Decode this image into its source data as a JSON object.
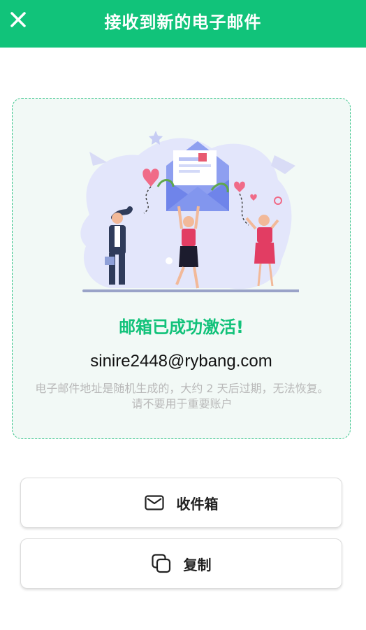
{
  "header": {
    "title": "接收到新的电子邮件",
    "close_icon": "close-icon"
  },
  "card": {
    "success_title": "邮箱已成功激活!",
    "email": "sinire2448@rybang.com",
    "hint": "电子邮件地址是随机生成的，大约 2 天后过期，无法恢复。请不要用于重要账户"
  },
  "actions": {
    "inbox": {
      "label": "收件箱",
      "icon": "mail-icon"
    },
    "copy": {
      "label": "复制",
      "icon": "copy-icon"
    }
  },
  "colors": {
    "brand": "#11c37a",
    "card_border": "#34c489",
    "card_bg": "#f2f9f6"
  }
}
